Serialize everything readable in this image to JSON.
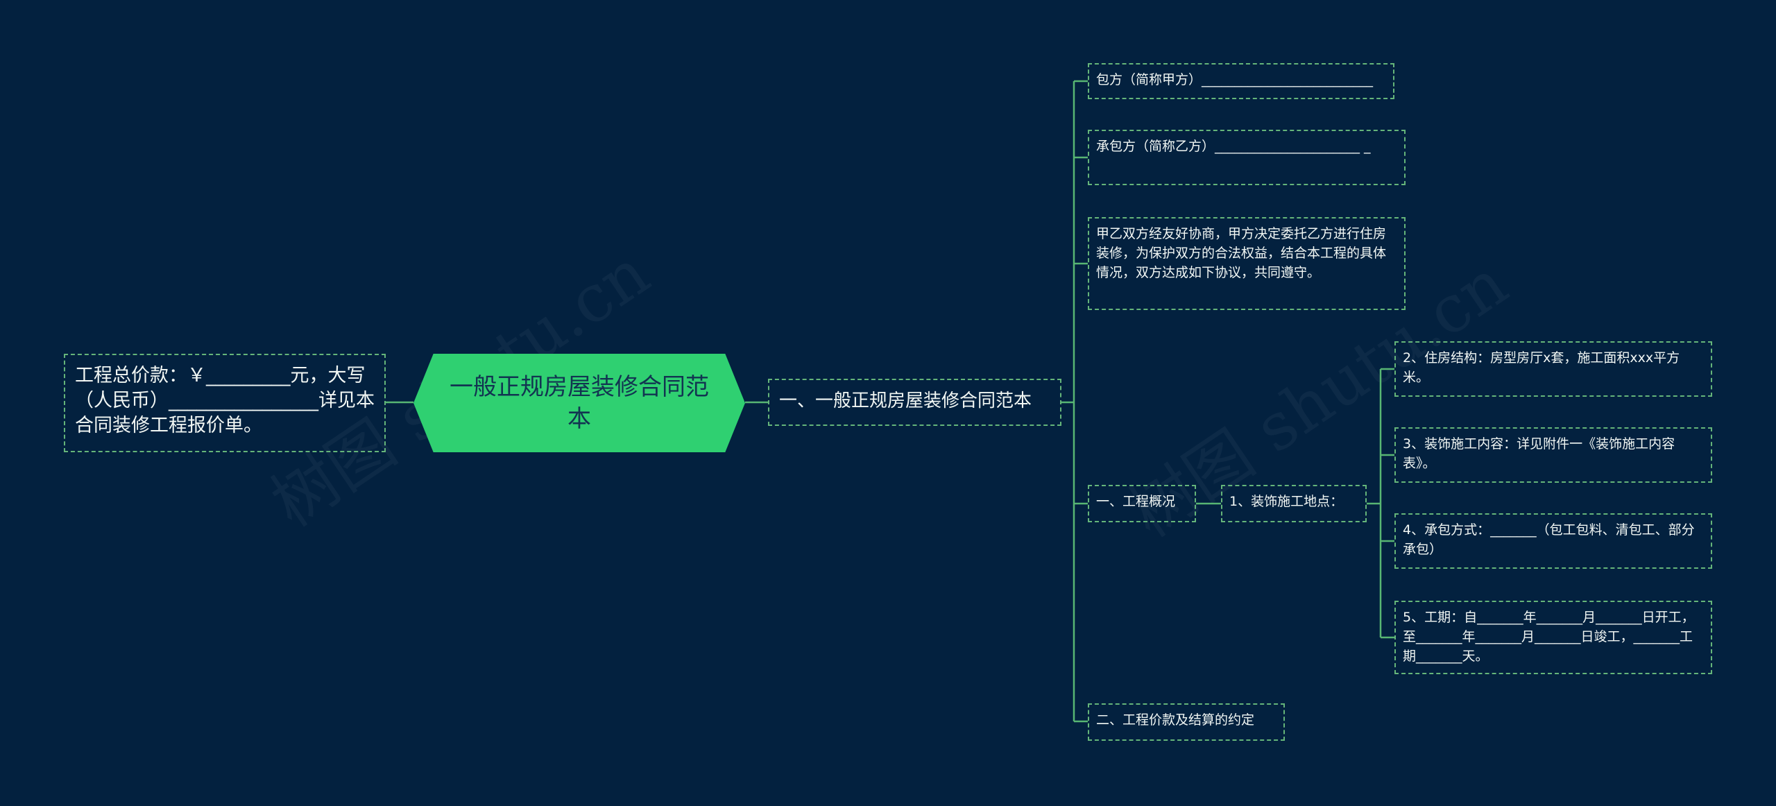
{
  "watermark": {
    "left": "树图 shutu.cn",
    "right": "树图 shutu.cn"
  },
  "mindmap": {
    "center": "一般正规房屋装修合同范本",
    "left_node": "工程总价款：￥_________元，大写（人民币）________________详见本合同装修工程报价单。",
    "level1": "一、一般正规房屋装修合同范本",
    "level2": {
      "party_a": "包方（简称甲方）__________________________",
      "party_b": "承包方（简称乙方）______________________ _",
      "agreement": "甲乙双方经友好协商，甲方决定委托乙方进行住房装修，为保护双方的合法权益，结合本工程的具体情况，双方达成如下协议，共同遵守。",
      "overview": "一、工程概况",
      "price_terms": "二、工程价款及结算的约定"
    },
    "level3": {
      "location": "1、装饰施工地点："
    },
    "level4": {
      "structure": "2、住房结构：房型房厅x套，施工面积xxx平方米。",
      "content": "3、装饰施工内容：详见附件一《装饰施工内容表》。",
      "method": "4、承包方式：_______（包工包料、清包工、部分承包）",
      "schedule": "5、工期：自_______年_______月_______日开工，至_______年_______月_______日竣工，_______工期_______天。"
    }
  },
  "colors": {
    "background": "#03213f",
    "accent_green": "#2fd071",
    "connector_green": "#58b673",
    "text": "#f2f7f4"
  }
}
